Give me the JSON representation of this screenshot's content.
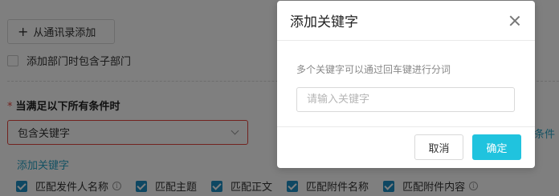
{
  "background": {
    "add_contact_button": "从通讯录添加",
    "include_sub_departments_label": "添加部门时包含子部门",
    "conditions_title": "当满足以下所有条件时",
    "required_mark": "*",
    "condition_select_value": "包含关键字",
    "add_keyword_link": "添加关键字",
    "right_link_partial": "条件",
    "options": [
      {
        "label": "匹配发件人名称",
        "checked": true,
        "info": true
      },
      {
        "label": "匹配主题",
        "checked": true,
        "info": false
      },
      {
        "label": "匹配正文",
        "checked": true,
        "info": false
      },
      {
        "label": "匹配附件名称",
        "checked": true,
        "info": false
      },
      {
        "label": "匹配附件内容",
        "checked": true,
        "info": true
      }
    ],
    "info_glyph": "i"
  },
  "modal": {
    "title": "添加关键字",
    "hint": "多个关键字可以通过回车键进行分词",
    "input_value": "",
    "input_placeholder": "请输入关键字",
    "cancel_label": "取消",
    "ok_label": "确定"
  },
  "colors": {
    "accent": "#20c3de",
    "link": "#2aa4c7",
    "error": "#e5453d",
    "checkbox": "#1c8ec4"
  }
}
